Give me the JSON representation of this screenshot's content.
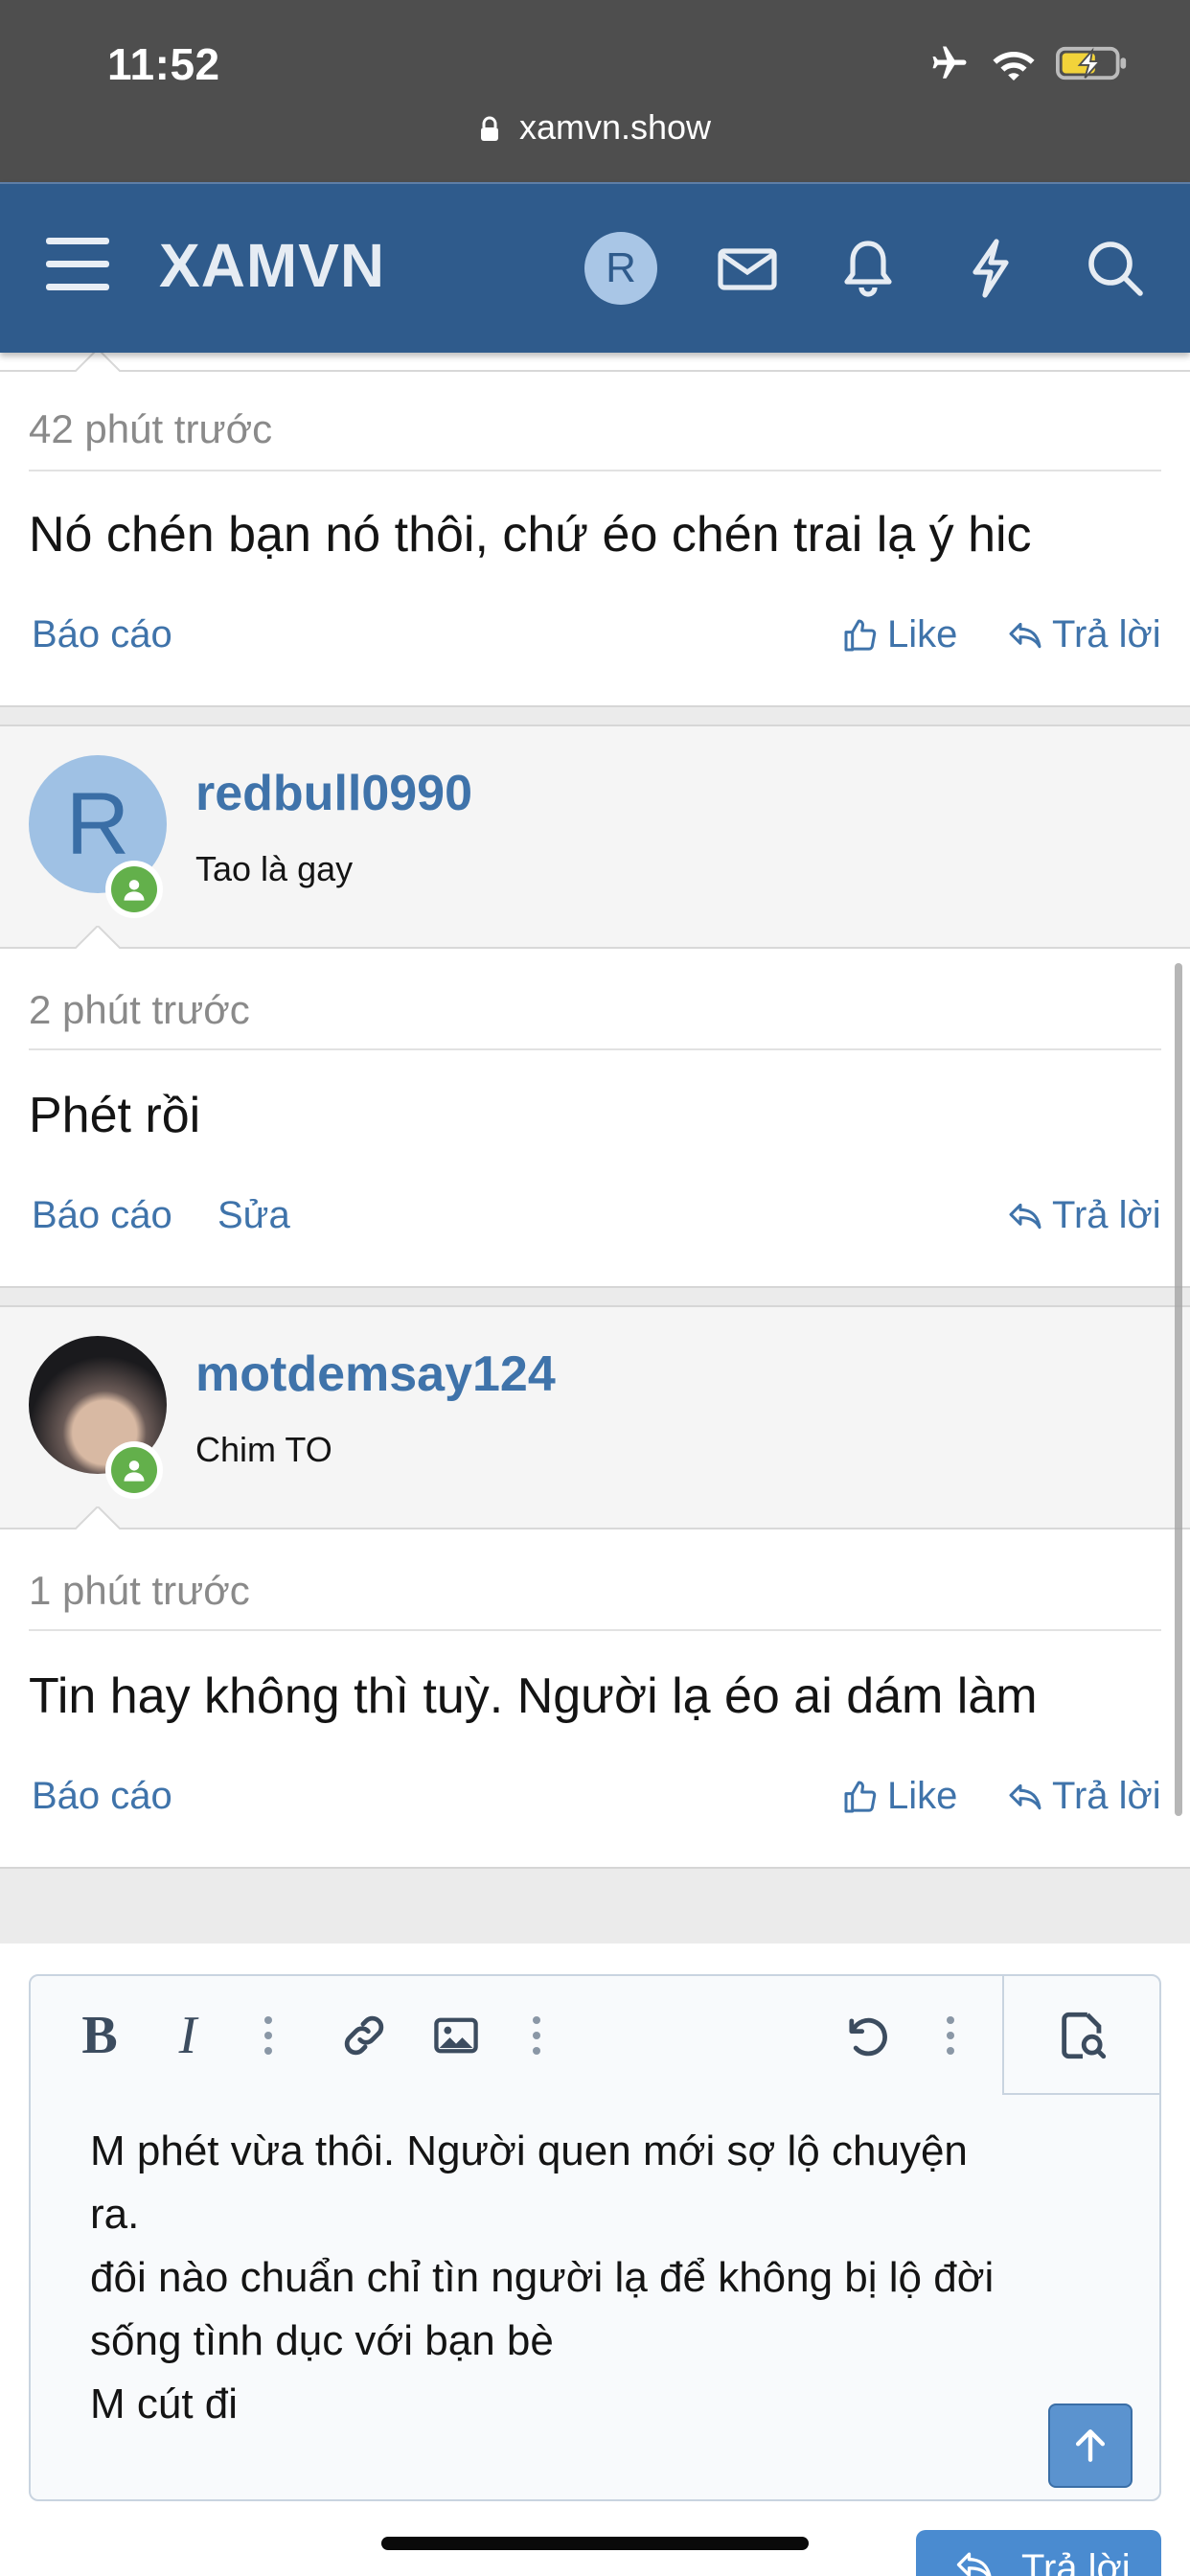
{
  "status_bar": {
    "time": "11:52",
    "url": "xamvn.show"
  },
  "header": {
    "brand": "XAMVN",
    "avatar_letter": "R",
    "icons": [
      "menu-icon",
      "mail-icon",
      "bell-icon",
      "lightning-icon",
      "search-icon"
    ]
  },
  "posts": [
    {
      "time": "42 phút trước",
      "text": "Nó chén bạn nó thôi, chứ éo chén trai lạ ý hic",
      "report": "Báo cáo",
      "like": "Like",
      "reply": "Trả lời"
    },
    {
      "user": {
        "name": "redbull0990",
        "title": "Tao là gay",
        "avatar_letter": "R"
      },
      "time": "2 phút trước",
      "text": "Phét rồi",
      "report": "Báo cáo",
      "edit": "Sửa",
      "reply": "Trả lời"
    },
    {
      "user": {
        "name": "motdemsay124",
        "title": "Chim TO"
      },
      "time": "1 phút trước",
      "text": "Tin hay không thì tuỳ. Người lạ éo ai dám làm",
      "report": "Báo cáo",
      "like": "Like",
      "reply": "Trả lời"
    }
  ],
  "editor": {
    "lines": [
      "M phét vừa thôi. Người quen mới sợ lộ chuyện",
      "ra.",
      "đôi nào chuẩn chỉ tìn người lạ để không bị lộ đời",
      "sống tình dục với bạn bè",
      "M cút đi"
    ],
    "toolbar": {
      "bold": "B",
      "italic": "I"
    }
  },
  "reply_button": "Trả lời",
  "colors": {
    "brand": "#2f5b8c",
    "link": "#3f73aa",
    "online": "#63b04b"
  }
}
